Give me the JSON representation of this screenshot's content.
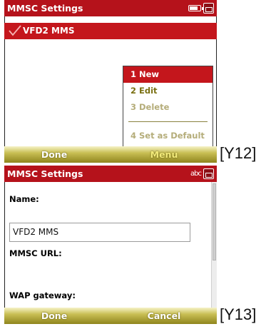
{
  "screen1": {
    "title": "MMSC Settings",
    "list_items": [
      {
        "label": "VFD2 MMS",
        "checked": true
      }
    ],
    "menu": {
      "items": [
        {
          "label": "1 New",
          "state": "selected"
        },
        {
          "label": "2 Edit",
          "state": "enabled"
        },
        {
          "label": "3 Delete",
          "state": "disabled"
        },
        {
          "label": "4 Set as Default",
          "state": "disabled"
        }
      ]
    },
    "softkeys": {
      "left": "Done",
      "right": "Menu"
    },
    "caption": "[Y12]"
  },
  "screen2": {
    "title": "MMSC Settings",
    "input_indicator": "abc",
    "fields": {
      "name_label": "Name:",
      "name_value": "VFD2 MMS",
      "mmsc_url_label": "MMSC URL:",
      "wap_gateway_label": "WAP gateway:"
    },
    "softkeys": {
      "left": "Done",
      "right": "Cancel"
    },
    "caption": "[Y13]"
  },
  "colors": {
    "title_bar": "#b5121b",
    "selection": "#c4161c",
    "softkey_bar": "#c9bf54",
    "menu_text": "#7a7012"
  },
  "icons": [
    "battery-icon",
    "phone-signal-icon",
    "checkmark-icon",
    "input-mode-icon"
  ]
}
